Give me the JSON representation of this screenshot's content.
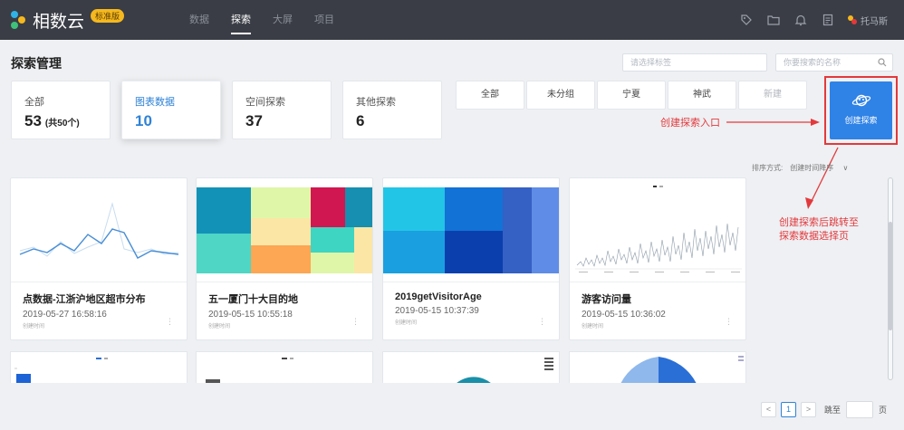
{
  "app": {
    "name": "相数云",
    "edition": "标准版"
  },
  "nav": [
    {
      "label": "数据",
      "active": false
    },
    {
      "label": "探索",
      "active": true
    },
    {
      "label": "大屏",
      "active": false
    },
    {
      "label": "项目",
      "active": false
    }
  ],
  "user": {
    "name": "托马斯"
  },
  "page": {
    "title": "探索管理",
    "tag_placeholder": "请选择标签",
    "search_placeholder": "你要搜索的名称"
  },
  "stats": [
    {
      "label": "全部",
      "value": "53",
      "sub": "(共50个)"
    },
    {
      "label": "图表数据",
      "value": "10",
      "sub": ""
    },
    {
      "label": "空间探索",
      "value": "37",
      "sub": ""
    },
    {
      "label": "其他探索",
      "value": "6",
      "sub": ""
    }
  ],
  "groups": [
    "全部",
    "未分组",
    "宁夏",
    "神武",
    "新建"
  ],
  "create_button": {
    "label": "创建探索"
  },
  "annotations": {
    "entry": "创建探索入口",
    "redirect_line1": "创建探索后跳转至",
    "redirect_line2": "探索数据选择页"
  },
  "sort": {
    "label": "排序方式:",
    "value": "创建时间降序"
  },
  "cards": [
    {
      "name": "点数据-江浙沪地区超市分布",
      "date": "2019-05-27 16:58:16",
      "caption": "创建时间"
    },
    {
      "name": "五一厦门十大目的地",
      "date": "2019-05-15 10:55:18",
      "caption": "创建时间"
    },
    {
      "name": "2019getVisitorAge",
      "date": "2019-05-15 10:37:39",
      "caption": "创建时间"
    },
    {
      "name": "游客访问量",
      "date": "2019-05-15 10:36:02",
      "caption": "创建时间"
    }
  ],
  "pagination": {
    "current": "1",
    "jump_label": "跳至",
    "page_unit": "页"
  },
  "colors": {
    "topbar": "#3a3d45",
    "accent": "#2e82d6",
    "create_bg": "#2f82e6",
    "annotation": "#e3393c",
    "badge": "#f5b81e"
  }
}
